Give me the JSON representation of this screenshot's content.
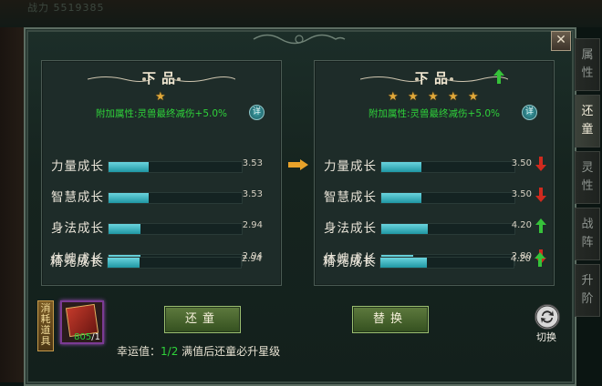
{
  "background": {
    "top_text": "战力 5519385"
  },
  "dialog": {
    "close_label": "✕"
  },
  "left_panel": {
    "quality": "下品",
    "stars": 1,
    "bonus": "附加属性:灵兽最终减伤+5.0%",
    "info_label": "详",
    "stats": [
      {
        "label": "力量成长",
        "value": "3.53",
        "fill": 0.3
      },
      {
        "label": "智慧成长",
        "value": "3.53",
        "fill": 0.3
      },
      {
        "label": "身法成长",
        "value": "2.94",
        "fill": 0.24
      },
      {
        "label": "体魄成长",
        "value": "2.94",
        "fill": 0.24
      },
      {
        "label": "精元成长",
        "value": "2.94",
        "fill": 0.24
      }
    ]
  },
  "right_panel": {
    "quality": "下品",
    "quality_trend": "up",
    "stars": 5,
    "bonus": "附加属性:灵兽最终减伤+5.0%",
    "info_label": "详",
    "stats": [
      {
        "label": "力量成长",
        "value": "3.50",
        "fill": 0.3,
        "trend": "down"
      },
      {
        "label": "智慧成长",
        "value": "3.50",
        "fill": 0.3,
        "trend": "down"
      },
      {
        "label": "身法成长",
        "value": "4.20",
        "fill": 0.35,
        "trend": "up"
      },
      {
        "label": "体魄成长",
        "value": "2.80",
        "fill": 0.24,
        "trend": "down"
      },
      {
        "label": "精元成长",
        "value": "4.20",
        "fill": 0.35,
        "trend": "up"
      }
    ]
  },
  "bottom": {
    "consume_label": "消耗道具",
    "item_count_have": "805",
    "item_count_need": "/1",
    "revert_button": "还童",
    "replace_button": "替换",
    "luck_label": "幸运值：",
    "luck_value": "1/2",
    "luck_hint": " 满值后还童必升星级",
    "swap_label": "切换"
  },
  "side_tabs": [
    {
      "label": "属性",
      "active": false
    },
    {
      "label": "还童",
      "active": true
    },
    {
      "label": "灵性",
      "active": false
    },
    {
      "label": "战阵",
      "active": false
    },
    {
      "label": "升阶",
      "active": false
    }
  ],
  "colors": {
    "bar": "#1f97a3",
    "up": "#36c23a",
    "down": "#d02a1e",
    "bonus_text": "#2fd23a",
    "star": "#e0a83a"
  }
}
